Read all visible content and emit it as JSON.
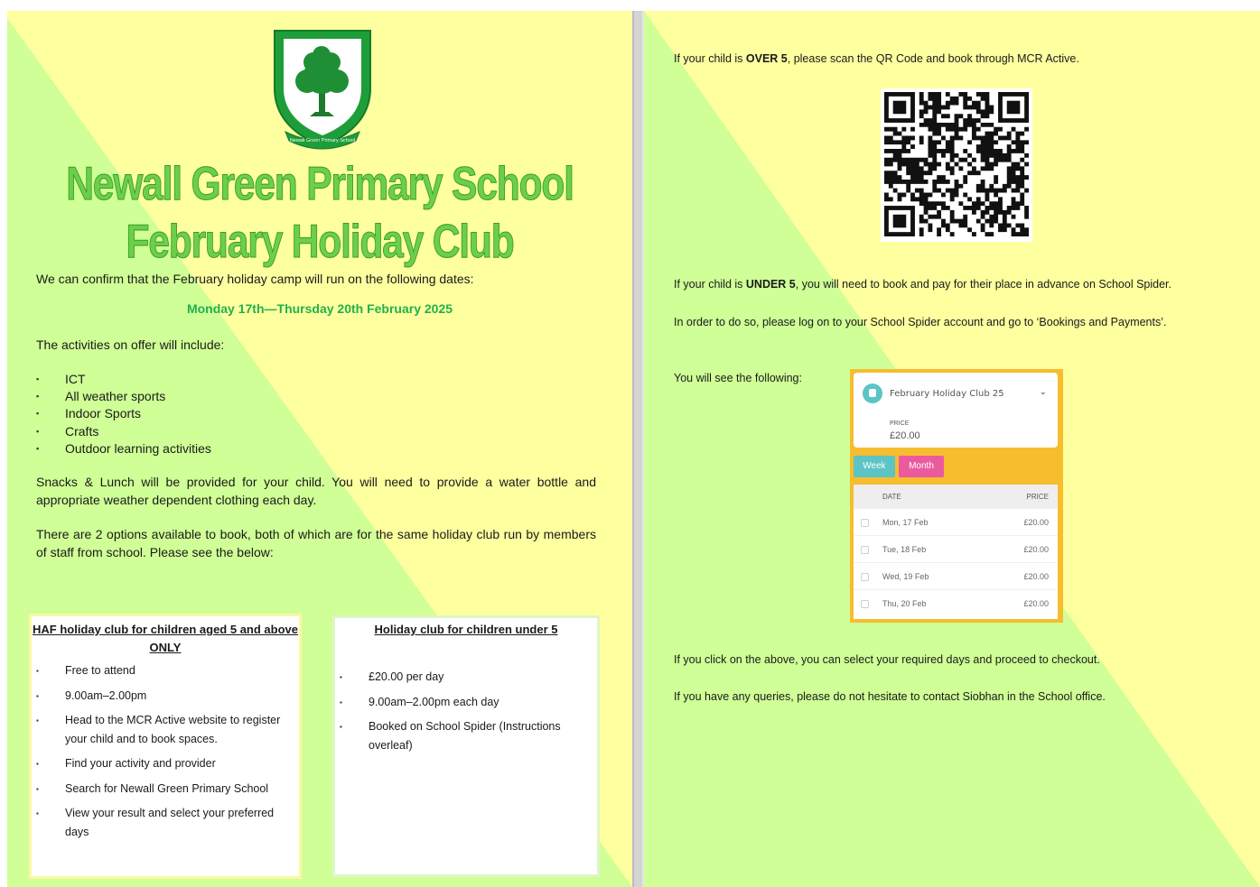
{
  "left_page": {
    "title_line1": "Newall Green Primary School",
    "title_line2": "February Holiday Club",
    "intro": "We can confirm that the February holiday camp will run on the following dates:",
    "dates": "Monday 17th—Thursday 20th February 2025",
    "activities_intro": "The activities on offer will include:",
    "activities": [
      "ICT",
      "All weather sports",
      "Indoor Sports",
      "Crafts",
      "Outdoor learning activities"
    ],
    "snacks_text": "Snacks & Lunch will be provided for your child. You will need to provide a water bottle and appropriate weather dependent clothing each day.",
    "options_text": "There are 2 options available to book, both of which are for the same holiday club run by members of staff from school. Please see the below:",
    "crest_text": "Newall Green Primary School",
    "box_haf": {
      "title_line1": "HAF holiday club for children aged 5 and above",
      "title_line2": "ONLY",
      "items": [
        "Free to attend",
        "9.00am–2.00pm",
        "Head to the MCR Active website to register your child and to book spaces.",
        "Find your activity and provider",
        "Search for Newall Green Primary School",
        "View your result and select your preferred days"
      ]
    },
    "box_under5": {
      "title": "Holiday club for children under 5",
      "items": [
        "£20.00 per day",
        "9.00am–2.00pm each day",
        "Booked on School Spider (Instructions overleaf)"
      ]
    }
  },
  "right_page": {
    "over5_pre": "If your child is ",
    "over5_bold": "OVER 5",
    "over5_post": ", please scan the QR Code and book through MCR Active.",
    "under5_pre": "If your child is ",
    "under5_bold": "UNDER 5",
    "under5_post": ", you will need to book and pay for their place in advance on School Spider.",
    "login_text": "In order to do so, please log on to your School Spider account and go to ‘Bookings and Payments’.",
    "see_following": "You will see the following:",
    "click_text": "If you click on the above, you can select your required days and proceed to checkout.",
    "queries_text": "If you have any queries, please do not hesitate to contact Siobhan in the School office."
  },
  "booking_widget": {
    "event_name": "February Holiday Club 25",
    "price_label": "PRICE",
    "price": "£20.00",
    "tab_week": "Week",
    "tab_month": "Month",
    "col_date": "DATE",
    "col_price": "PRICE",
    "rows": [
      {
        "date": "Mon, 17 Feb",
        "price": "£20.00"
      },
      {
        "date": "Tue, 18 Feb",
        "price": "£20.00"
      },
      {
        "date": "Wed, 19 Feb",
        "price": "£20.00"
      },
      {
        "date": "Thu, 20 Feb",
        "price": "£20.00"
      }
    ]
  },
  "colors": {
    "yellow_bg": "#feff9f",
    "green_bg": "#cfff96",
    "title_green": "#6ccf4a",
    "date_green": "#22b14c",
    "widget_orange": "#f6bd2f",
    "week_tab": "#5cc4c4",
    "month_tab": "#ec5a9e"
  },
  "icons": {
    "crest": "school-crest-icon",
    "qr": "qr-code-icon",
    "bullet": "square-bullet-icon",
    "widget_event": "calendar-icon",
    "dropdown": "chevron-down-icon"
  }
}
